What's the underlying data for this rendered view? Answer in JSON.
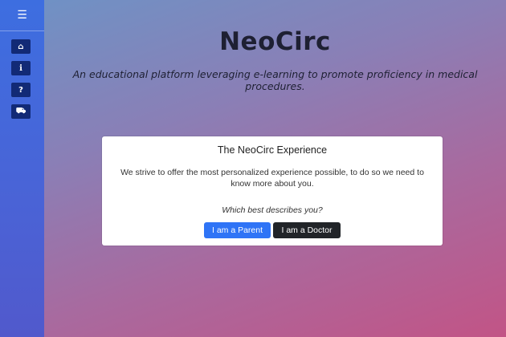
{
  "app": {
    "title": "NeoCirc",
    "tagline": "An educational platform leveraging e-learning to promote proficiency in medical procedures."
  },
  "sidebar": {
    "menu_icon": "☰",
    "items": [
      {
        "icon": "home-icon",
        "glyph": "⌂"
      },
      {
        "icon": "info-icon",
        "glyph": "i"
      },
      {
        "icon": "question-icon",
        "glyph": "?"
      },
      {
        "icon": "ambulance-icon",
        "glyph": "⛟"
      }
    ]
  },
  "card": {
    "title": "The NeoCirc Experience",
    "text": "We strive to offer the most personalized experience possible, to do so we need to know more about you.",
    "question": "Which best describes you?",
    "parent_button": "I am a Parent",
    "doctor_button": "I am a Doctor"
  },
  "colors": {
    "sidebar": "#4a63d6",
    "sidebar_button": "#122a76",
    "primary_button": "#2f74f6",
    "dark_button": "#212428"
  }
}
